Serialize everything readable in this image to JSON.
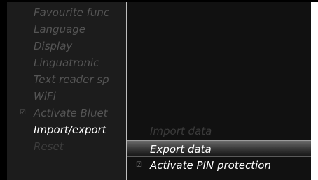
{
  "left_menu": {
    "items": [
      {
        "label": "Favourite func",
        "checkbox": false,
        "state": "muted"
      },
      {
        "label": "Language",
        "checkbox": false,
        "state": "muted"
      },
      {
        "label": "Display",
        "checkbox": false,
        "state": "muted"
      },
      {
        "label": "Linguatronic",
        "checkbox": false,
        "state": "muted"
      },
      {
        "label": "Text reader sp",
        "checkbox": false,
        "state": "muted"
      },
      {
        "label": "WiFi",
        "checkbox": false,
        "state": "muted"
      },
      {
        "label": "Activate Bluet",
        "checkbox": true,
        "state": "muted"
      },
      {
        "label": "Import/export",
        "checkbox": false,
        "state": "active"
      },
      {
        "label": "Reset",
        "checkbox": false,
        "state": "dim"
      }
    ]
  },
  "submenu": {
    "items": [
      {
        "label": "Import data",
        "checkbox": false,
        "state": "disabled"
      },
      {
        "label": "Export data",
        "checkbox": false,
        "state": "selected"
      },
      {
        "label": "Activate PIN protection",
        "checkbox": true,
        "state": "normal"
      }
    ]
  },
  "colors": {
    "background": "#000000",
    "left_panel": "#1c1c1c",
    "right_panel": "#111111",
    "highlight_top": "#6a6a6a",
    "highlight_bottom": "#161616",
    "text_active": "#ffffff",
    "text_muted": "#7a7a7a",
    "text_disabled": "#3b3b3b"
  },
  "icons": {
    "checkbox": "checkbox-checked-icon"
  }
}
